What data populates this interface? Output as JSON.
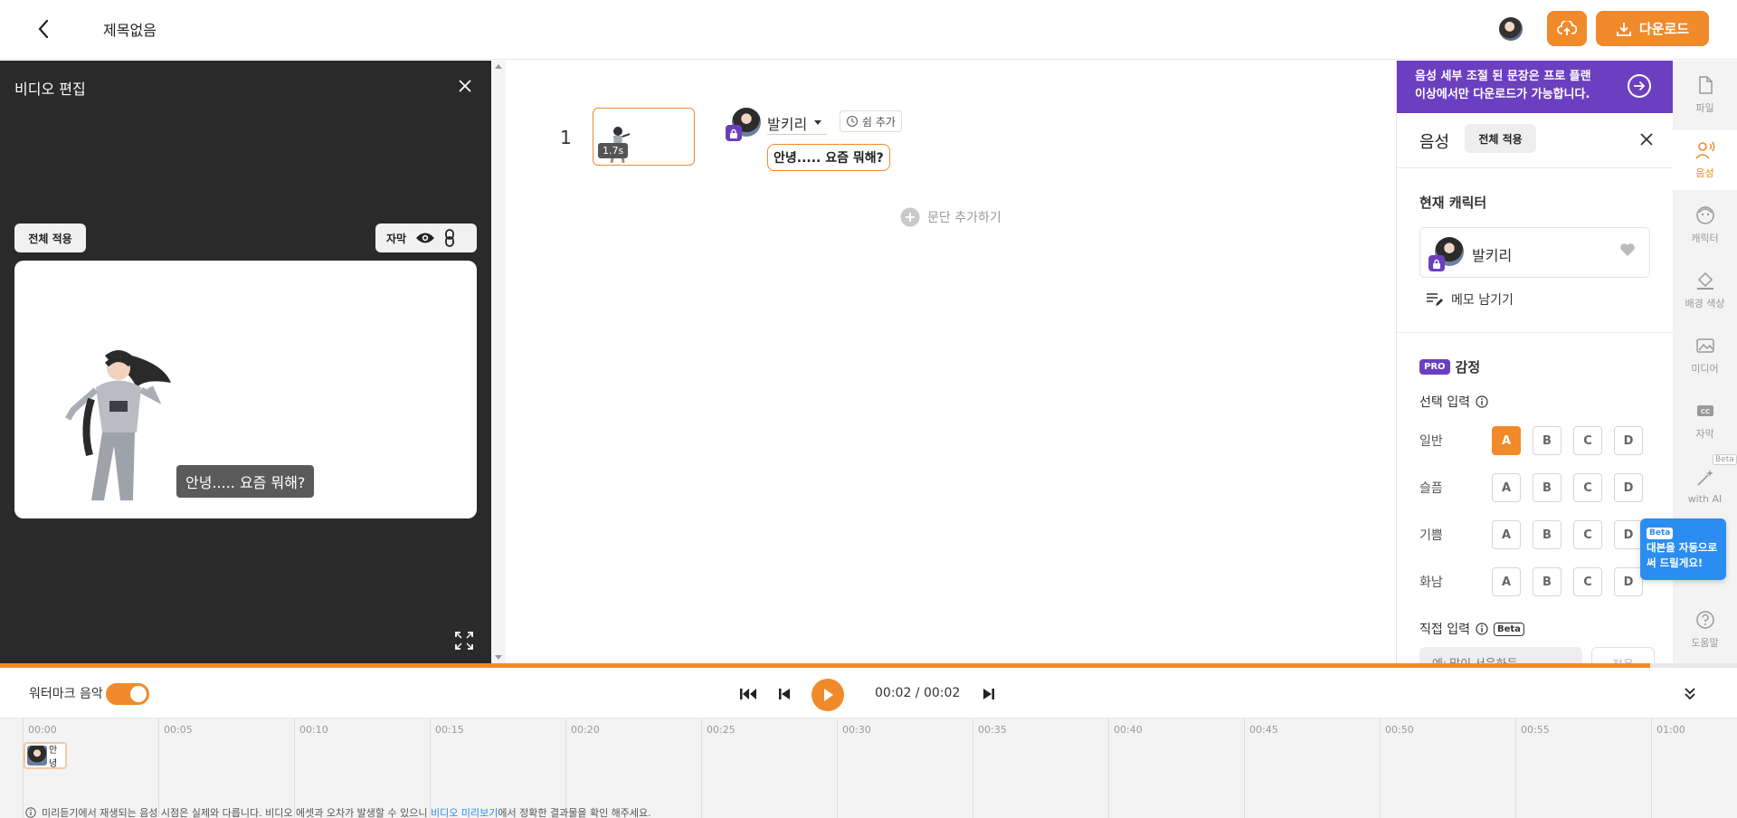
{
  "header": {
    "title": "제목없음",
    "download_label": "다운로드"
  },
  "video_panel": {
    "title": "비디오 편집",
    "apply_all": "전체 적용",
    "subtitle_label": "자막",
    "preview_subtitle": "안녕..... 요즘 뭐해?"
  },
  "script": {
    "row_number": "1",
    "scene_duration": "1.7s",
    "speaker_name": "발키리",
    "rest_add": "쉼 추가",
    "line_text": "안녕..... 요즘 뭐해?",
    "add_paragraph": "문단 추가하기"
  },
  "voice_panel": {
    "banner_line1": "음성 세부 조절 된 문장은 프로 플랜",
    "banner_line2": "이상에서만 다운로드가 가능합니다.",
    "title": "음성",
    "apply_all": "전체 적용",
    "current_character_title": "현재 캐릭터",
    "character_name": "발키리",
    "memo_label": "메모 남기기",
    "pro_badge": "PRO",
    "emotion_title": "감정",
    "select_input_label": "선택 입력",
    "emotions": [
      {
        "label": "일반",
        "options": [
          "A",
          "B",
          "C",
          "D"
        ],
        "selected": "A"
      },
      {
        "label": "슬픔",
        "options": [
          "A",
          "B",
          "C",
          "D"
        ],
        "selected": ""
      },
      {
        "label": "기쁨",
        "options": [
          "A",
          "B",
          "C",
          "D"
        ],
        "selected": ""
      },
      {
        "label": "화남",
        "options": [
          "A",
          "B",
          "C",
          "D"
        ],
        "selected": ""
      }
    ],
    "direct_input_label": "직접 입력",
    "beta_label": "Beta",
    "direct_input_placeholder": "예: 많이 서운하듯",
    "direct_apply": "적용"
  },
  "side_rail": {
    "items": [
      {
        "label": "파일",
        "icon": "file-icon",
        "active": false
      },
      {
        "label": "음성",
        "icon": "voice-icon",
        "active": true
      },
      {
        "label": "캐릭터",
        "icon": "character-icon",
        "active": false
      },
      {
        "label": "배경 색상",
        "icon": "paint-bucket-icon",
        "active": false
      },
      {
        "label": "미디어",
        "icon": "image-icon",
        "active": false
      },
      {
        "label": "자막",
        "icon": "cc-icon",
        "active": false
      },
      {
        "label": "with AI",
        "icon": "ai-wand-icon",
        "active": false
      },
      {
        "label": "도움말",
        "icon": "help-icon",
        "active": false
      }
    ],
    "ai_beta_tag": "Beta",
    "tooltip_badge": "Beta",
    "tooltip_line1": "대본을 자동으로",
    "tooltip_line2": "써 드릴게요!"
  },
  "player": {
    "watermark_label": "워터마크 음악",
    "watermark_on": true,
    "time": "00:02 / 00:02",
    "progress": 0.95
  },
  "timeline": {
    "ticks": [
      "00:00",
      "00:05",
      "00:10",
      "00:15",
      "00:20",
      "00:25",
      "00:30",
      "00:35",
      "00:40",
      "00:45",
      "00:50",
      "00:55",
      "01:00"
    ],
    "clip_text": "안녕",
    "note_before": "미리듣기에서 재생되는 음성 시점은 실제와 다릅니다. 비디오 에셋과 오차가 발생할 수 있으니",
    "note_link": "비디오 미리보기",
    "note_after": "에서 정확한 결과물을 확인 해주세요."
  },
  "colors": {
    "accent": "#f08a2b",
    "pro_purple": "#6b3fbf",
    "info_blue": "#2b8df0",
    "dark_panel": "#2a2a2a"
  }
}
